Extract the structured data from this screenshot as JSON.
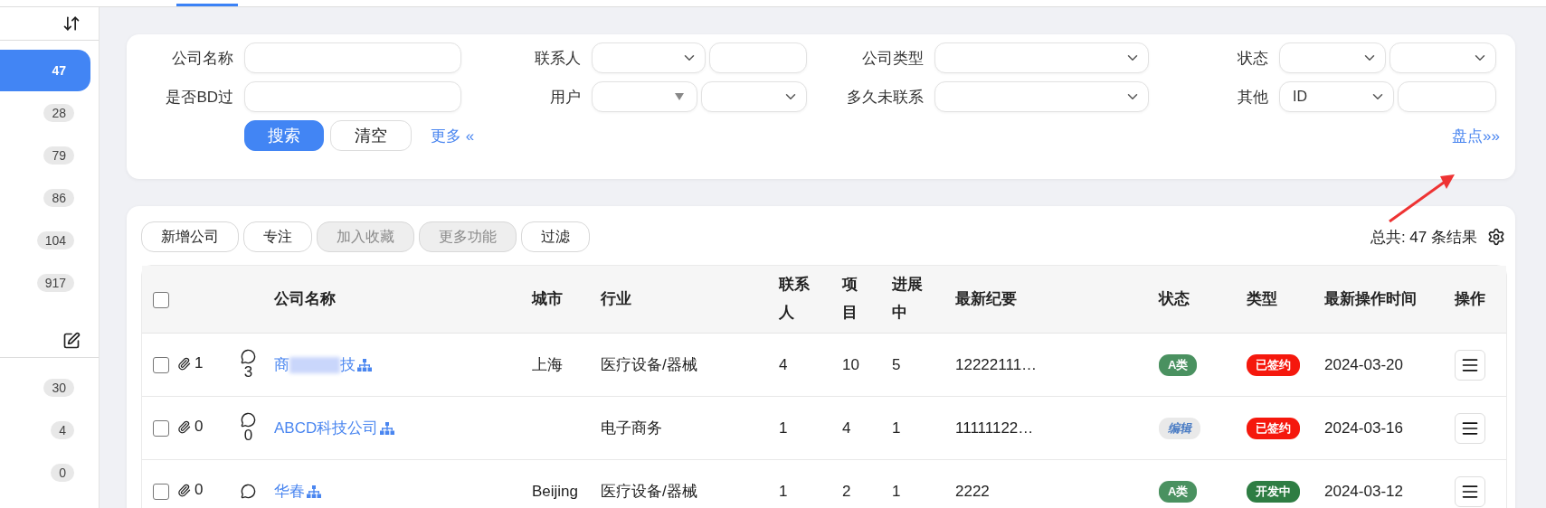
{
  "sidebar": {
    "groups": [
      {
        "kind": "sort",
        "items": [
          {
            "count": "47",
            "selected": true
          },
          {
            "count": "28",
            "selected": false
          },
          {
            "count": "79",
            "selected": false
          },
          {
            "count": "86",
            "selected": false
          },
          {
            "count": "104",
            "selected": false
          },
          {
            "count": "917",
            "selected": false
          }
        ]
      },
      {
        "kind": "edit",
        "items": [
          {
            "count": "30",
            "selected": false
          },
          {
            "count": "4",
            "selected": false
          },
          {
            "count": "0",
            "selected": false
          }
        ]
      }
    ]
  },
  "filters": {
    "rows": [
      [
        {
          "label": "公司名称",
          "controls": [
            {
              "kind": "input"
            }
          ]
        },
        {
          "label": "联系人",
          "controls": [
            {
              "kind": "select"
            },
            {
              "kind": "input"
            }
          ]
        },
        {
          "label": "公司类型",
          "controls": [
            {
              "kind": "select"
            }
          ]
        },
        {
          "label": "状态",
          "controls": [
            {
              "kind": "select"
            },
            {
              "kind": "select"
            }
          ]
        }
      ],
      [
        {
          "label": "是否BD过",
          "controls": [
            {
              "kind": "input"
            }
          ]
        },
        {
          "label": "用户",
          "controls": [
            {
              "kind": "dropdown"
            },
            {
              "kind": "select"
            }
          ]
        },
        {
          "label": "多久未联系",
          "controls": [
            {
              "kind": "select"
            }
          ]
        },
        {
          "label": "其他",
          "controls": [
            {
              "kind": "select",
              "value": "ID"
            },
            {
              "kind": "input"
            }
          ]
        }
      ]
    ],
    "actions": [
      {
        "label": "搜索",
        "kind": "primary"
      },
      {
        "label": "清空",
        "kind": "default"
      }
    ],
    "more_link": "更多 «",
    "inventory_link": "盘点»»"
  },
  "toolbar": {
    "buttons": [
      {
        "label": "新增公司",
        "disabled": false
      },
      {
        "label": "专注",
        "disabled": false
      },
      {
        "label": "加入收藏",
        "disabled": true
      },
      {
        "label": "更多功能",
        "disabled": true
      },
      {
        "label": "过滤",
        "disabled": false
      }
    ],
    "result_count": "总共: 47 条结果"
  },
  "table": {
    "header_checked": false,
    "columns": [
      "公司名称",
      "城市",
      "行业",
      "联系人",
      "项目",
      "进展中",
      "最新纪要",
      "状态",
      "类型",
      "最新操作时间",
      "操作"
    ],
    "rows": [
      {
        "checked": false,
        "attachments": "1",
        "comments": "3",
        "name": "商",
        "name_after_redaction": "技",
        "city": "上海",
        "industry": "医疗设备/器械",
        "contacts": "4",
        "projects": "10",
        "in_progress": "5",
        "summary": "12222111…",
        "status": {
          "text": "A类",
          "kind": "grade"
        },
        "type": {
          "text": "已签约",
          "color": "#f5180d"
        },
        "time": "2024-03-20"
      },
      {
        "checked": false,
        "attachments": "0",
        "comments": "0",
        "name": "ABCD科技公司",
        "city": "",
        "industry": "电子商务",
        "contacts": "1",
        "projects": "4",
        "in_progress": "1",
        "summary": "11111122…",
        "status": {
          "text": "编辑",
          "kind": "edit"
        },
        "type": {
          "text": "已签约",
          "color": "#f5180d"
        },
        "time": "2024-03-16"
      },
      {
        "checked": false,
        "attachments": "0",
        "comments": "",
        "name": "华春",
        "city": "Beijing",
        "industry": "医疗设备/器械",
        "contacts": "1",
        "projects": "2",
        "in_progress": "1",
        "summary": "2222",
        "status": {
          "text": "A类",
          "kind": "grade"
        },
        "type": {
          "text": "开发中",
          "color": "#2e7d43"
        },
        "time": "2024-03-12"
      }
    ]
  }
}
